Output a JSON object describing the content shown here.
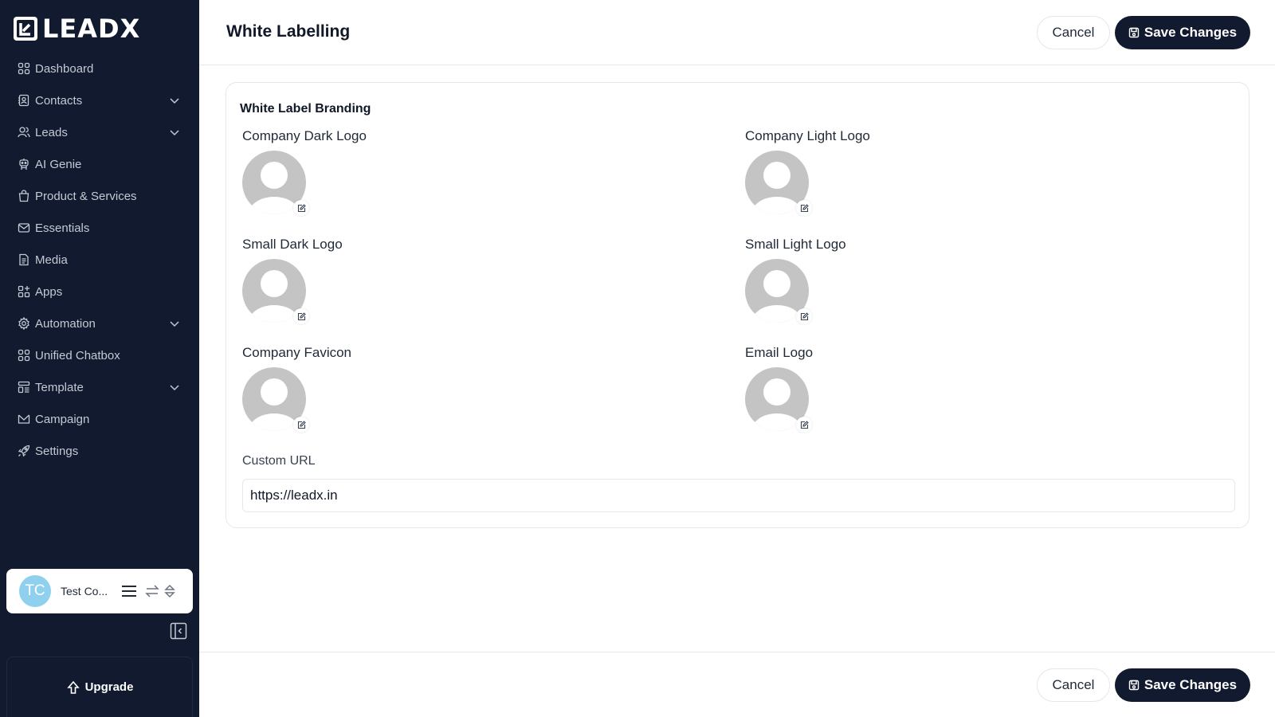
{
  "brand": {
    "name": "LEADX",
    "logo_icon": "leadx-logo-icon"
  },
  "sidebar": {
    "items": [
      {
        "label": "Dashboard",
        "icon": "grid-icon",
        "expandable": false
      },
      {
        "label": "Contacts",
        "icon": "contact-book-icon",
        "expandable": true
      },
      {
        "label": "Leads",
        "icon": "users-icon",
        "expandable": true
      },
      {
        "label": "AI Genie",
        "icon": "robot-icon",
        "expandable": false
      },
      {
        "label": "Product & Services",
        "icon": "shopping-bag-icon",
        "expandable": false
      },
      {
        "label": "Essentials",
        "icon": "mail-icon",
        "expandable": false
      },
      {
        "label": "Media",
        "icon": "document-icon",
        "expandable": false
      },
      {
        "label": "Apps",
        "icon": "apps-icon",
        "expandable": false
      },
      {
        "label": "Automation",
        "icon": "gear-cog-icon",
        "expandable": true
      },
      {
        "label": "Unified Chatbox",
        "icon": "grid-icon",
        "expandable": false
      },
      {
        "label": "Template",
        "icon": "template-icon",
        "expandable": true
      },
      {
        "label": "Campaign",
        "icon": "campaign-icon",
        "expandable": false
      },
      {
        "label": "Settings",
        "icon": "rocket-icon",
        "expandable": false
      }
    ],
    "account": {
      "initials": "TC",
      "name": "Test Co...",
      "avatar_color": "#8fd0ee"
    },
    "upgrade_label": "Upgrade"
  },
  "header": {
    "title": "White Labelling",
    "cancel_label": "Cancel",
    "save_label": "Save Changes"
  },
  "branding": {
    "title": "White Label Branding",
    "fields": [
      {
        "label": "Company Dark Logo"
      },
      {
        "label": "Company Light Logo"
      },
      {
        "label": "Small Dark Logo"
      },
      {
        "label": "Small Light Logo"
      },
      {
        "label": "Company Favicon"
      },
      {
        "label": "Email Logo"
      }
    ],
    "custom_url_label": "Custom URL",
    "custom_url_value": "https://leadx.in"
  },
  "footer": {
    "cancel_label": "Cancel",
    "save_label": "Save Changes"
  },
  "colors": {
    "sidebar_bg": "#111a2e",
    "primary_button": "#111a2e",
    "placeholder_gray": "#c4c4c4"
  }
}
